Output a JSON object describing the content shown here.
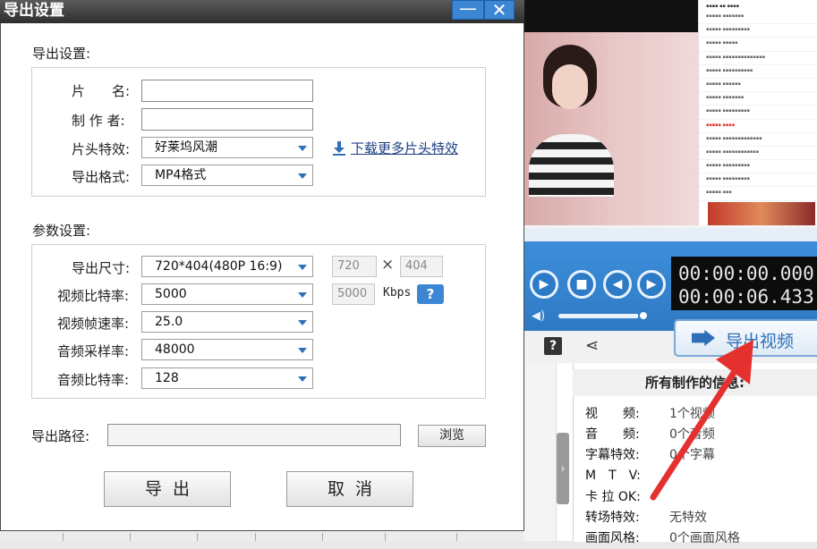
{
  "dialog": {
    "title": "导出设置",
    "minimize": "—",
    "close": "✕"
  },
  "export_section": {
    "label": "导出设置:",
    "name_label": "片　　名:",
    "author_label": "制 作 者:",
    "intro_label": "片头特效:",
    "intro_value": "好莱坞风潮",
    "download_link": "下载更多片头特效",
    "format_label": "导出格式:",
    "format_value": "MP4格式"
  },
  "params_section": {
    "label": "参数设置:",
    "size_label": "导出尺寸:",
    "size_value": "720*404(480P 16:9)",
    "width": "720",
    "height": "404",
    "times_sign": "×",
    "vbitrate_label": "视频比特率:",
    "vbitrate_value": "5000",
    "vbitrate_display": "5000",
    "kbps": "Kbps",
    "help": "?",
    "fps_label": "视频帧速率:",
    "fps_value": "25.0",
    "asample_label": "音频采样率:",
    "asample_value": "48000",
    "abitrate_label": "音频比特率:",
    "abitrate_value": "128"
  },
  "path": {
    "label": "导出路径:",
    "value": "",
    "browse": "浏览"
  },
  "buttons": {
    "export": "导出",
    "cancel": "取消"
  },
  "editor": {
    "timecode_current": "00:00:00.000",
    "timecode_total": "00:00:06.433",
    "export_video": "导出视频",
    "help_icon": "?",
    "info_title": "所有制作的信息:",
    "info_rows": [
      {
        "label": "视　　频:",
        "value": "1个视频"
      },
      {
        "label": "音　　频:",
        "value": "0个音频"
      },
      {
        "label": "字幕特效:",
        "value": "0个字幕"
      },
      {
        "label": "M　T　V:",
        "value": ""
      },
      {
        "label": "卡 拉 OK:",
        "value": ""
      },
      {
        "label": "转场特效:",
        "value": "无特效"
      },
      {
        "label": "画面风格:",
        "value": "0个画面风格"
      }
    ]
  },
  "colors": {
    "accent": "#3d86d4",
    "arrow": "#e53030",
    "link": "#1d3f83",
    "titlebar": "#3a3a3a"
  }
}
